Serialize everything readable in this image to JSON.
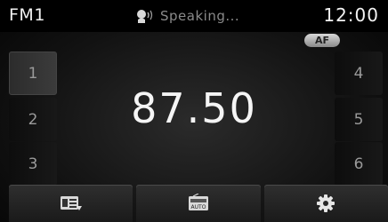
{
  "status_bar": {
    "band": "FM1",
    "speaking_text": "Speaking...",
    "time": "12:00"
  },
  "badges": {
    "af": "AF"
  },
  "main": {
    "frequency": "87.50"
  },
  "presets": {
    "left": [
      {
        "label": "1",
        "active": true
      },
      {
        "label": "2",
        "active": false
      },
      {
        "label": "3",
        "active": false
      }
    ],
    "right": [
      {
        "label": "4",
        "active": false
      },
      {
        "label": "5",
        "active": false
      },
      {
        "label": "6",
        "active": false
      }
    ]
  },
  "bottom_bar": {
    "buttons": [
      {
        "icon": "radio-list-icon"
      },
      {
        "icon": "radio-auto-icon",
        "icon_text": "AUTO"
      },
      {
        "icon": "gear-icon"
      }
    ]
  }
}
